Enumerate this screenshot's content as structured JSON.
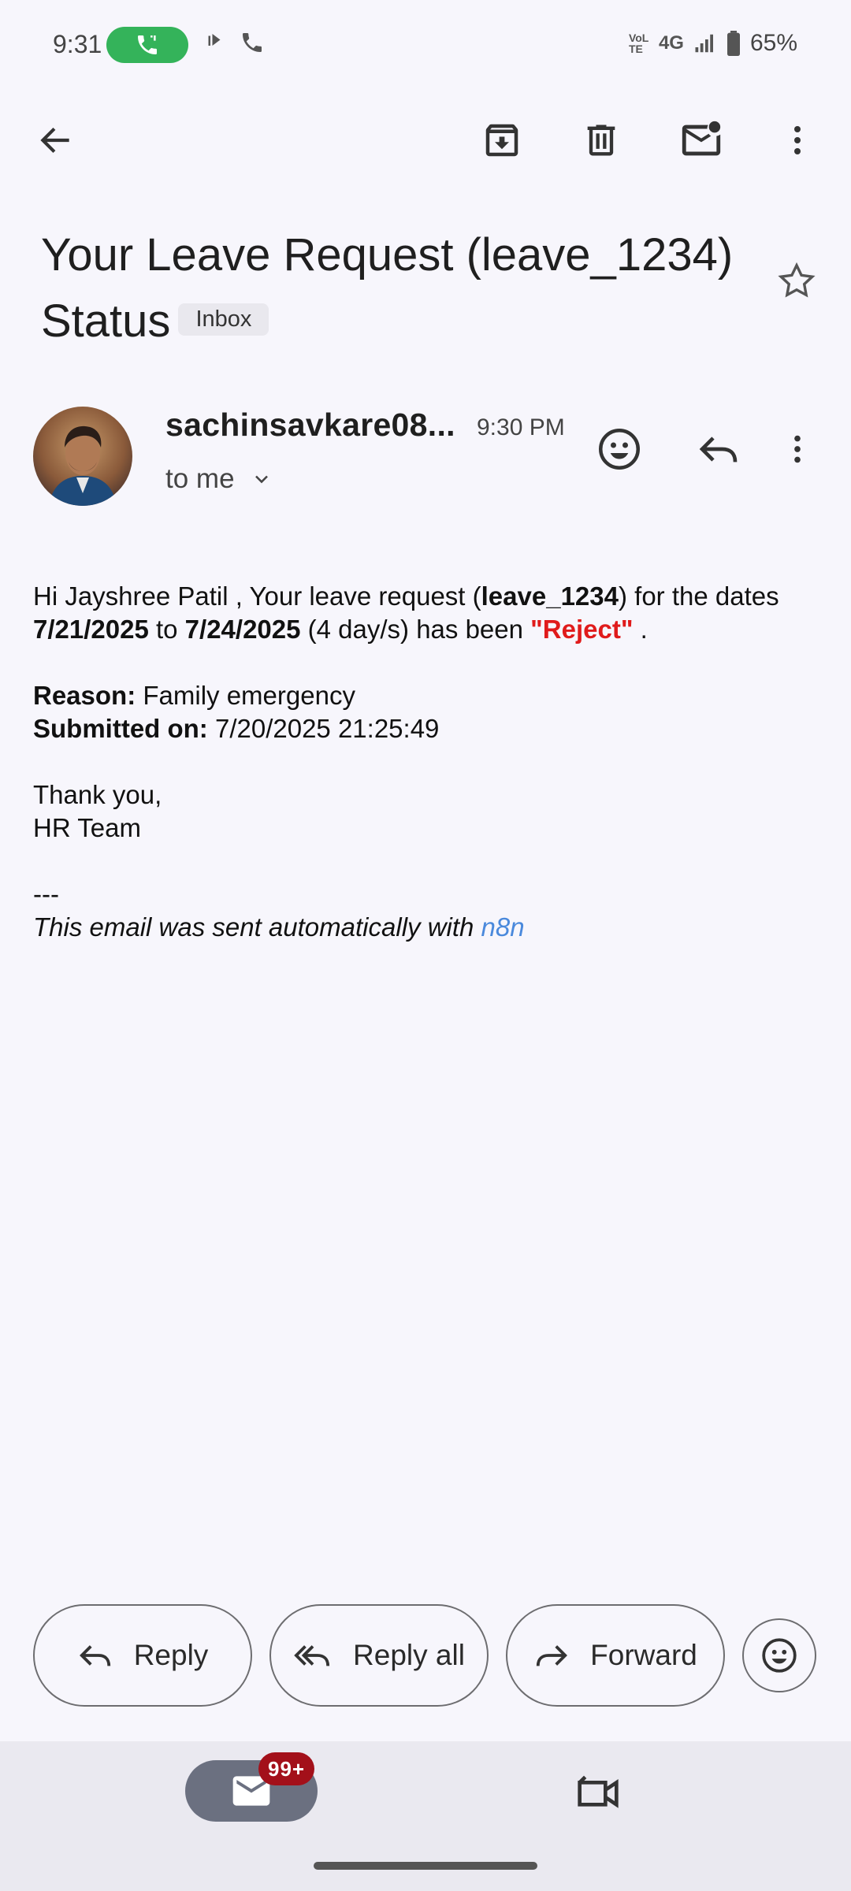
{
  "status_bar": {
    "time": "9:31",
    "network_label": "4G",
    "volte_label": "VoLTE",
    "battery": "65%"
  },
  "toolbar": {
    "back": "arrow-left-icon",
    "archive": "archive-icon",
    "delete": "trash-icon",
    "mark_unread": "mail-unread-icon",
    "more": "more-vert-icon"
  },
  "email": {
    "subject": "Your Leave Request (leave_1234) Status",
    "label_chip": "Inbox",
    "sender": "sachinsavkare08...",
    "time": "9:30 PM",
    "recipient": "to me",
    "body": {
      "greeting_pre": "Hi Jayshree Patil , Your leave request (",
      "request_id": "leave_1234",
      "dates_pre": ") for the dates ",
      "start_date": "7/21/2025",
      "to_word": " to ",
      "end_date": "7/24/2025",
      "duration": " (4 day/s) has been ",
      "status": "\"Reject\"",
      "period": " .",
      "reason_label": "Reason:",
      "reason_value": " Family emergency",
      "submitted_label": "Submitted on:",
      "submitted_value": " 7/20/2025 21:25:49",
      "signoff_1": "Thank you,",
      "signoff_2": "HR Team",
      "separator": "---",
      "footer_pre": "This email was sent automatically with ",
      "footer_link": "n8n"
    }
  },
  "actions": {
    "reply": "Reply",
    "reply_all": "Reply all",
    "forward": "Forward"
  },
  "bottom_nav": {
    "mail_badge": "99+"
  },
  "colors": {
    "background": "#f7f6fc",
    "reject": "#e01b1b",
    "link": "#4a89dc",
    "badge": "#a3101a",
    "call_pill": "#34b35a"
  }
}
